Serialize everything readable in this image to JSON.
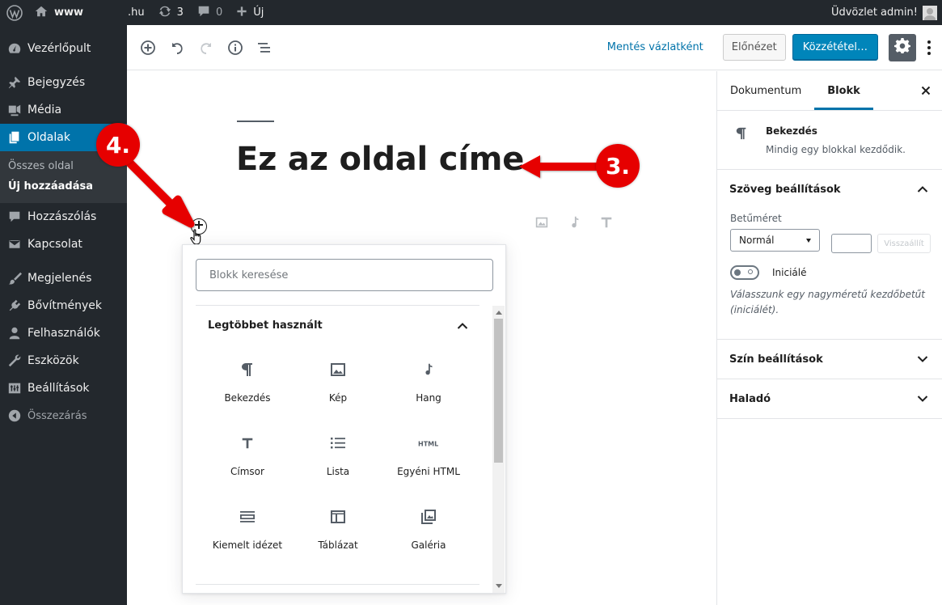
{
  "admin_bar": {
    "site_left": "www",
    "site_right": ".hu",
    "updates_count": "3",
    "comments_count": "0",
    "new_label": "Új",
    "greeting": "Üdvözlet admin!"
  },
  "sidebar": {
    "items": [
      {
        "label": "Vezérlőpult",
        "icon": "dashboard-icon"
      },
      {
        "label": "Bejegyzés",
        "icon": "pin-icon"
      },
      {
        "label": "Média",
        "icon": "media-icon"
      },
      {
        "label": "Oldalak",
        "icon": "pages-icon"
      },
      {
        "label": "Hozzászólás",
        "icon": "comment-icon"
      },
      {
        "label": "Kapcsolat",
        "icon": "mail-icon"
      },
      {
        "label": "Megjelenés",
        "icon": "brush-icon"
      },
      {
        "label": "Bővítmények",
        "icon": "plugin-icon"
      },
      {
        "label": "Felhasználók",
        "icon": "user-icon"
      },
      {
        "label": "Eszközök",
        "icon": "wrench-icon"
      },
      {
        "label": "Beállítások",
        "icon": "settings-icon"
      },
      {
        "label": "Összezárás",
        "icon": "collapse-icon"
      }
    ],
    "submenu": [
      "Összes oldal",
      "Új hozzáadása"
    ]
  },
  "header": {
    "save_draft": "Mentés vázlatként",
    "preview": "Előnézet",
    "publish": "Közzététel…"
  },
  "content": {
    "title": "Ez az oldal címe"
  },
  "inserter": {
    "search_placeholder": "Blokk keresése",
    "panel_title": "Legtöbbet használt",
    "blocks": [
      {
        "label": "Bekezdés",
        "icon": "paragraph-icon"
      },
      {
        "label": "Kép",
        "icon": "image-icon"
      },
      {
        "label": "Hang",
        "icon": "audio-icon"
      },
      {
        "label": "Címsor",
        "icon": "heading-icon"
      },
      {
        "label": "Lista",
        "icon": "list-icon"
      },
      {
        "label": "Egyéni HTML",
        "icon": "html-icon"
      },
      {
        "label": "Kiemelt idézet",
        "icon": "pullquote-icon"
      },
      {
        "label": "Táblázat",
        "icon": "table-icon"
      },
      {
        "label": "Galéria",
        "icon": "gallery-icon"
      }
    ]
  },
  "settings": {
    "tabs": [
      "Dokumentum",
      "Blokk"
    ],
    "block_name": "Bekezdés",
    "block_desc": "Mindig egy blokkal kezdődik.",
    "text_settings": "Szöveg beállítások",
    "font_size_label": "Betűméret",
    "font_size_value": "Normál",
    "reset": "Visszaállít",
    "dropcap_label": "Iniciálé",
    "dropcap_help": "Válasszunk egy nagyméretű kezdőbetűt (iniciálét).",
    "color_settings": "Szín beállítások",
    "advanced": "Haladó"
  },
  "annotations": {
    "step3": "3.",
    "step4": "4."
  },
  "colors": {
    "admin_bg": "#23282d",
    "accent": "#0073aa",
    "annotation_red": "#e60000"
  }
}
